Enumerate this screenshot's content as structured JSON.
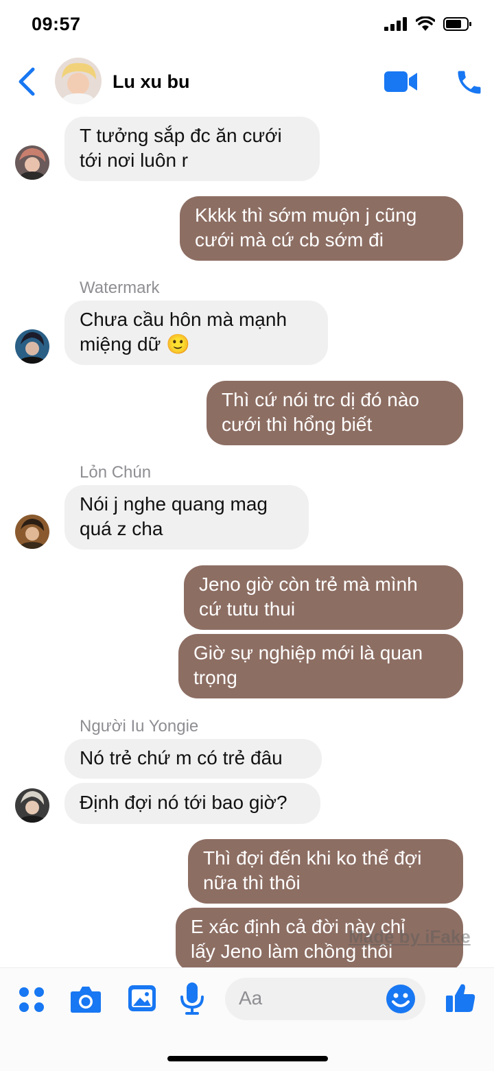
{
  "status": {
    "time": "09:57"
  },
  "header": {
    "name": "Lu xu bu"
  },
  "messages": [
    {
      "text": "T tưởng sắp đc ăn cưới\ntới nơi luôn r"
    },
    {
      "text": "Kkkk thì sớm muộn j cũng\ncưới mà cứ cb sớm đi"
    },
    {
      "sender": "Watermark",
      "text": "Chưa cầu hôn mà mạnh\nmiệng dữ 🙂"
    },
    {
      "text": "Thì cứ nói trc dị đó nào\ncưới thì hổng biết"
    },
    {
      "sender": "Lỏn Chún",
      "text": "Nói j nghe quang mag\nquá z cha"
    },
    {
      "text": "Jeno giờ còn trẻ mà mình\ncứ tutu thui"
    },
    {
      "text": "Giờ sự nghiệp mới là quan\ntrọng"
    },
    {
      "sender": "Người Iu Yongie",
      "text": "Nó trẻ chứ m có trẻ đâu"
    },
    {
      "text": "Định đợi nó tới bao giờ?"
    },
    {
      "text": "Thì đợi đến khi ko thể đợi\nnữa thì thôi"
    },
    {
      "text": "E xác định cả đời này chỉ\nlấy Jeno làm chồng thôi"
    }
  ],
  "watermark": "Made by iFake",
  "composer": {
    "placeholder": "Aa"
  },
  "colors": {
    "accent": "#1877f2",
    "outgoing_bubble": "#8d6e63",
    "incoming_bubble": "#f0f0f0"
  },
  "icons": [
    "back-icon",
    "video-call-icon",
    "phone-icon",
    "apps-icon",
    "camera-icon",
    "gallery-icon",
    "microphone-icon",
    "emoji-icon",
    "like-icon"
  ]
}
